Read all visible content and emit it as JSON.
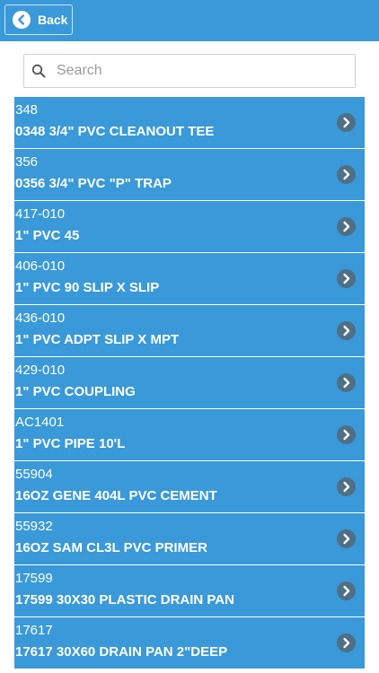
{
  "header": {
    "back_label": "Back"
  },
  "search": {
    "placeholder": "Search",
    "value": ""
  },
  "colors": {
    "accent": "#3a99d8",
    "chevron_bg": "#4f6f86"
  },
  "icons": {
    "back": "chevron-left-circle-icon",
    "search": "search-icon",
    "row": "chevron-right-circle-icon"
  },
  "items": [
    {
      "code": "348",
      "title": "0348 3/4\" PVC CLEANOUT TEE"
    },
    {
      "code": "356",
      "title": "0356 3/4\" PVC \"P\" TRAP"
    },
    {
      "code": "417-010",
      "title": "1\" PVC 45"
    },
    {
      "code": "406-010",
      "title": "1\" PVC 90 SLIP X SLIP"
    },
    {
      "code": "436-010",
      "title": "1\" PVC ADPT SLIP X MPT"
    },
    {
      "code": "429-010",
      "title": "1\" PVC COUPLING"
    },
    {
      "code": "AC1401",
      "title": "1\" PVC PIPE 10'L"
    },
    {
      "code": "55904",
      "title": "16OZ GENE 404L PVC CEMENT"
    },
    {
      "code": "55932",
      "title": "16OZ SAM CL3L PVC PRIMER"
    },
    {
      "code": "17599",
      "title": "17599 30X30 PLASTIC DRAIN PAN"
    },
    {
      "code": "17617",
      "title": "17617 30X60 DRAIN PAN 2\"DEEP"
    }
  ]
}
